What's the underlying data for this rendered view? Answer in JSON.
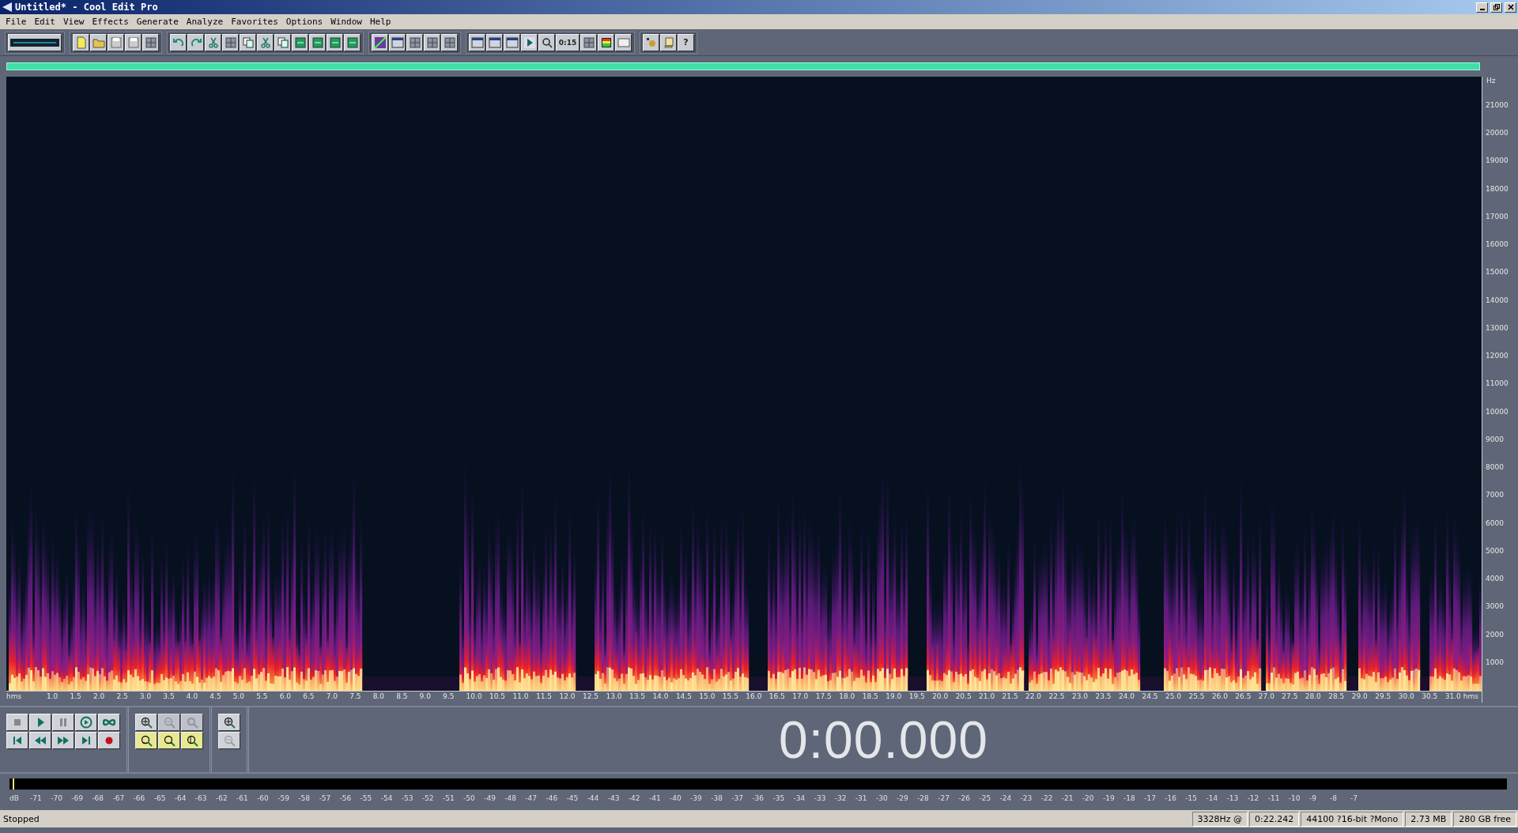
{
  "window": {
    "title": "Untitled* - Cool Edit Pro"
  },
  "menu": [
    "File",
    "Edit",
    "View",
    "Effects",
    "Generate",
    "Analyze",
    "Favorites",
    "Options",
    "Window",
    "Help"
  ],
  "toolbar": {
    "labels": [
      "0:15",
      "?"
    ]
  },
  "frequency_axis": {
    "unit": "Hz",
    "ticks": [
      "21000",
      "20000",
      "19000",
      "18000",
      "17000",
      "16000",
      "15000",
      "14000",
      "13000",
      "12000",
      "11000",
      "10000",
      "9000",
      "8000",
      "7000",
      "6000",
      "5000",
      "4000",
      "3000",
      "2000",
      "1000"
    ]
  },
  "time_axis": {
    "unit_left": "hms",
    "unit_right": "hms",
    "ticks": [
      "1.0",
      "1.5",
      "2.0",
      "2.5",
      "3.0",
      "3.5",
      "4.0",
      "4.5",
      "5.0",
      "5.5",
      "6.0",
      "6.5",
      "7.0",
      "7.5",
      "8.0",
      "8.5",
      "9.0",
      "9.5",
      "10.0",
      "10.5",
      "11.0",
      "11.5",
      "12.0",
      "12.5",
      "13.0",
      "13.5",
      "14.0",
      "14.5",
      "15.0",
      "15.5",
      "16.0",
      "16.5",
      "17.0",
      "17.5",
      "18.0",
      "18.5",
      "19.0",
      "19.5",
      "20.0",
      "20.5",
      "21.0",
      "21.5",
      "22.0",
      "22.5",
      "23.0",
      "23.5",
      "24.0",
      "24.5",
      "25.0",
      "25.5",
      "26.0",
      "26.5",
      "27.0",
      "27.5",
      "28.0",
      "28.5",
      "29.0",
      "29.5",
      "30.0",
      "30.5",
      "31.0"
    ]
  },
  "zoom_buttons": [
    {
      "kind": "zoom-in",
      "disabled": false
    },
    {
      "kind": "zoom-out",
      "disabled": true
    },
    {
      "kind": "zoom-full",
      "disabled": true
    },
    {
      "kind": "zoom-left",
      "disabled": false
    },
    {
      "kind": "zoom-right",
      "disabled": false
    },
    {
      "kind": "zoom-selection",
      "disabled": false
    }
  ],
  "vertical_zoom": [
    {
      "kind": "zoom-in",
      "disabled": false
    },
    {
      "kind": "zoom-out",
      "disabled": true
    }
  ],
  "time_display": "0:00.000",
  "level_meter": {
    "level": 0.003,
    "unit": "dB",
    "ticks": [
      "-71",
      "-70",
      "-69",
      "-68",
      "-67",
      "-66",
      "-65",
      "-64",
      "-63",
      "-62",
      "-61",
      "-60",
      "-59",
      "-58",
      "-57",
      "-56",
      "-55",
      "-54",
      "-53",
      "-52",
      "-51",
      "-50",
      "-49",
      "-48",
      "-47",
      "-46",
      "-45",
      "-44",
      "-43",
      "-42",
      "-41",
      "-40",
      "-39",
      "-38",
      "-37",
      "-36",
      "-35",
      "-34",
      "-33",
      "-32",
      "-31",
      "-30",
      "-29",
      "-28",
      "-27",
      "-26",
      "-25",
      "-24",
      "-23",
      "-22",
      "-21",
      "-20",
      "-19",
      "-18",
      "-17",
      "-16",
      "-15",
      "-14",
      "-13",
      "-12",
      "-11",
      "-10",
      "-9",
      "-8",
      "-7"
    ]
  },
  "status_bar": {
    "state": "Stopped",
    "cells": [
      "3328Hz @",
      "0:22.242",
      "44100 ?16-bit ?Mono",
      "2.73 MB",
      "280 GB free"
    ]
  }
}
